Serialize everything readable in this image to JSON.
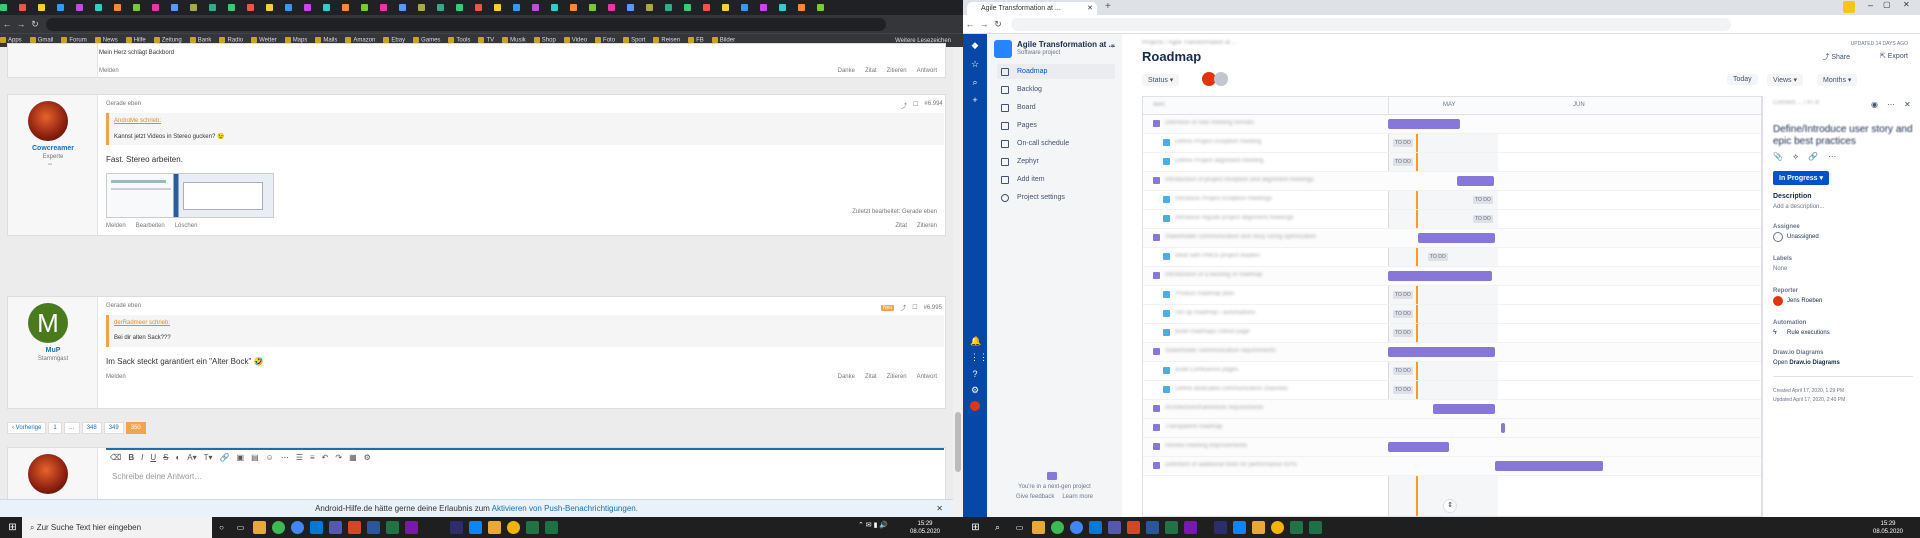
{
  "left_browser": {
    "bookmarks": [
      "Apps",
      "Gmail",
      "Forum",
      "News",
      "Hilfe",
      "Zeitung",
      "Bank",
      "Radio",
      "Wetter",
      "Maps",
      "Mails",
      "Amazon",
      "Ebay",
      "Games",
      "Tools",
      "TV",
      "Musik",
      "Shop",
      "Video",
      "Foto",
      "Sport",
      "Reisen",
      "FB",
      "Bilder"
    ],
    "bookmark_last": "Weitere Lesezeichen",
    "forum": {
      "post0": {
        "text": "Mein Herz schlägt Backbord",
        "report": "Melden",
        "actions": [
          "Danke",
          "Zitat",
          "Zitieren",
          "Antwort"
        ]
      },
      "post1": {
        "time": "Gerade eben",
        "number": "#6.994",
        "username": "Cowcreamer",
        "rank": "Experte",
        "quote_author": "AndroMe schrieb:",
        "quote_text": "Kannst jetzt Videos in Stereo gucken? 😉",
        "body": "Fast. Stereo arbeiten.",
        "edited": "Zuletzt bearbeitet: Gerade eben",
        "links": [
          "Melden",
          "Bearbeiten",
          "Löschen"
        ],
        "actions": [
          "Zitat",
          "Zitieren"
        ]
      },
      "post2": {
        "time": "Gerade eben",
        "badge": "Neu",
        "number": "#6.995",
        "avatar_letter": "M",
        "username": "MuP",
        "rank": "Stammgast",
        "quote_author": "derRadmeer schrieb:",
        "quote_text": "Bei dir alten Sack???",
        "body": "Im Sack steckt garantiert ein \"Alter Bock\" 🤣",
        "report": "Melden",
        "actions": [
          "Danke",
          "Zitat",
          "Zitieren",
          "Antwort"
        ]
      },
      "pager": [
        "‹ Vorherige",
        "1",
        "…",
        "348",
        "349",
        "350"
      ],
      "editor_placeholder": "Schreibe deine Antwort…",
      "notification": {
        "text": "Android-Hilfe.de hätte gerne deine Erlaubnis zum ",
        "link": "Aktivieren von Push-Benachrichtigungen."
      }
    }
  },
  "jira": {
    "project": {
      "name": "Agile Transformation at ...",
      "type": "Software project"
    },
    "sidebar": [
      "Roadmap",
      "Backlog",
      "Board",
      "Pages",
      "On-call schedule",
      "Zephyr",
      "Add item",
      "Project settings"
    ],
    "sidebar_footer": [
      "You're in a next-gen project",
      "Give feedback",
      "Learn more"
    ],
    "breadcrumb": "Projects / Agile Transformation at ...",
    "title": "Roadmap",
    "updated": "UPDATED 14 DAYS AGO",
    "share": "Share",
    "export": "Export",
    "status": "Status",
    "today": "Today",
    "views": "Views",
    "months": "Months",
    "grid_header": {
      "item": "Item",
      "months": [
        "MAY",
        "JUN"
      ]
    },
    "rows": [
      {
        "name": "Definition of new meeting formats",
        "kind": "epic"
      },
      {
        "name": "Define Project inception meeting",
        "kind": "story",
        "todo": "TO DO"
      },
      {
        "name": "Define Project alignment meeting",
        "kind": "story",
        "todo": "TO DO"
      },
      {
        "name": "Introduction of project inception and alignment meetings",
        "kind": "epic"
      },
      {
        "name": "Introduce Project inception meetings",
        "kind": "story",
        "todo": "TO DO"
      },
      {
        "name": "Introduce regular project alignment meetings",
        "kind": "story",
        "todo": "TO DO"
      },
      {
        "name": "Stakeholder communication and story sizing optimization",
        "kind": "epic"
      },
      {
        "name": "Meet with PMOs project leaders",
        "kind": "story",
        "todo": "TO DO"
      },
      {
        "name": "Introduction of a backlog of roadmap",
        "kind": "epic"
      },
      {
        "name": "Product roadmap plan",
        "kind": "story",
        "todo": "TO DO"
      },
      {
        "name": "Set up roadmap / automations",
        "kind": "story",
        "todo": "TO DO"
      },
      {
        "name": "Build roadmaps rollout page",
        "kind": "story",
        "todo": "TO DO"
      },
      {
        "name": "Stakeholder communication requirements",
        "kind": "epic"
      },
      {
        "name": "Build Confluence pages",
        "kind": "story",
        "todo": "TO DO"
      },
      {
        "name": "Define dedicated communication channels",
        "kind": "story",
        "todo": "TO DO"
      },
      {
        "name": "Architecture/framework requirements",
        "kind": "epic"
      },
      {
        "name": "Transparent roadmap",
        "kind": "epic"
      },
      {
        "name": "Review meeting improvements",
        "kind": "epic"
      },
      {
        "name": "Definition of additional tools for performance KPIs",
        "kind": "epic"
      }
    ],
    "detail": {
      "breadcrumb": "Connect ... / AT-6",
      "title": "Define/Introduce user story and epic best practices",
      "status_button": "In Progress",
      "description_label": "Description",
      "description_placeholder": "Add a description...",
      "assignee_label": "Assignee",
      "assignee": "Unassigned",
      "labels_label": "Labels",
      "labels": "None",
      "reporter_label": "Reporter",
      "reporter": "Jens Roeben",
      "automation_label": "Automation",
      "automation": "Rule executions",
      "drawio_label": "Draw.io Diagrams",
      "drawio_open": "Open ",
      "drawio_link": "Draw.io Diagrams",
      "created": "Created April 17, 2020, 1:29 PM",
      "updated": "Updated April 17, 2020, 2:40 PM"
    }
  },
  "taskbar": {
    "search": "Zur Suche Text hier eingeben",
    "time_left": "15:29",
    "date_left": "08.05.2020",
    "time_right": "15:29",
    "date_right": "08.05.2020"
  },
  "colors": {
    "jira_nav": "#0747a6",
    "epic_bar": "#8777d9",
    "today_line": "#ff991f",
    "forum_accent": "#f3a34c",
    "in_progress": "#0052cc"
  }
}
